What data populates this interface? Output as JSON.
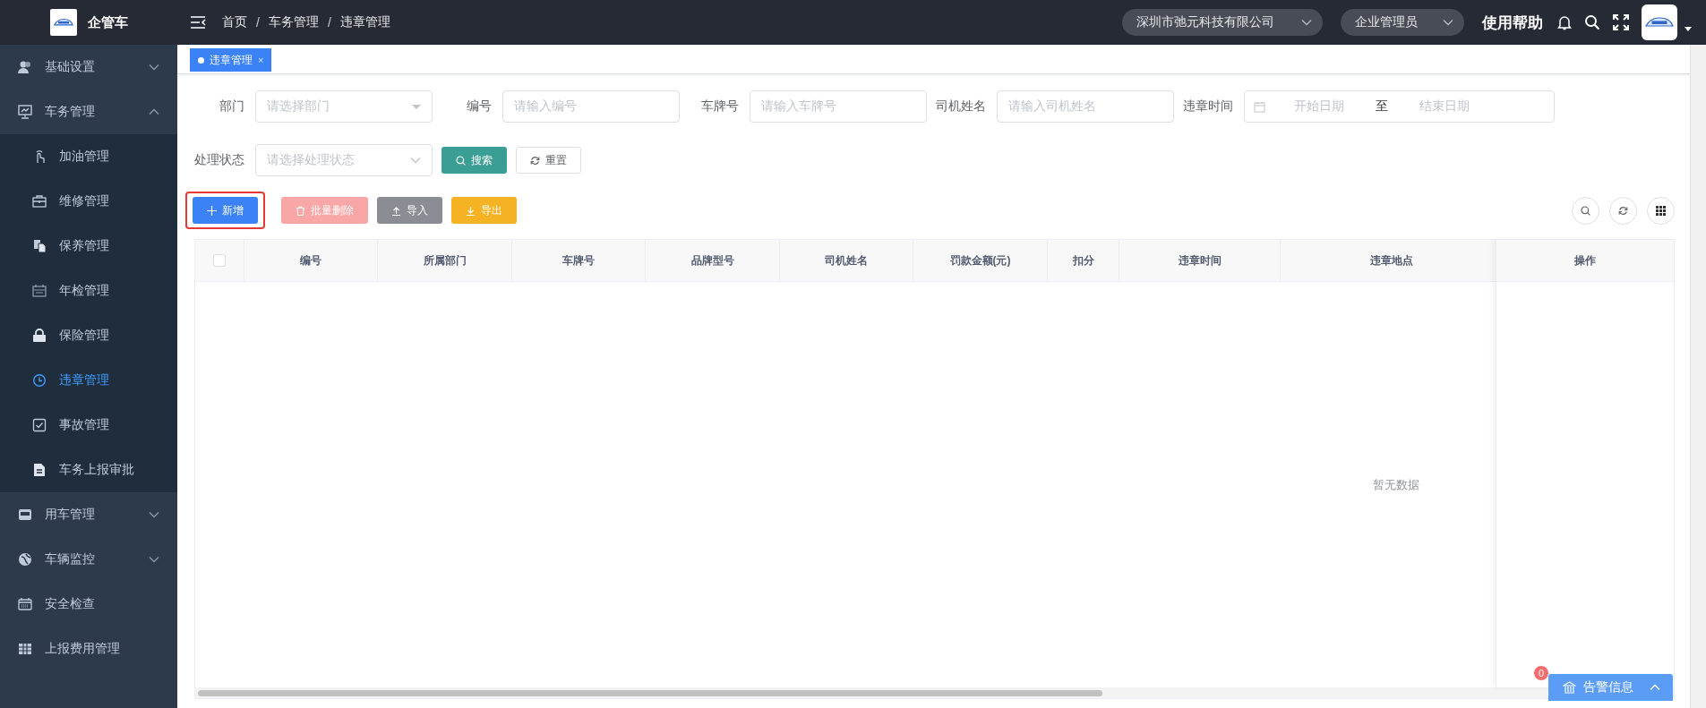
{
  "header": {
    "logo_text": "企管车",
    "breadcrumb": [
      {
        "label": "首页",
        "separator": "/"
      },
      {
        "label": "车务管理",
        "separator": "/"
      },
      {
        "label": "违章管理"
      }
    ],
    "company": "深圳市弛元科技有限公司",
    "role": "企业管理员",
    "help": "使用帮助"
  },
  "sidebar": {
    "items": [
      {
        "label": "基础设置",
        "selected": false,
        "expanded": false
      },
      {
        "label": "车务管理",
        "selected": false,
        "expanded": true,
        "children": [
          {
            "label": "加油管理",
            "selected": false
          },
          {
            "label": "维修管理",
            "selected": false
          },
          {
            "label": "保养管理",
            "selected": false
          },
          {
            "label": "年检管理",
            "selected": false
          },
          {
            "label": "保险管理",
            "selected": false
          },
          {
            "label": "违章管理",
            "selected": true
          },
          {
            "label": "事故管理",
            "selected": false
          },
          {
            "label": "车务上报审批",
            "selected": false
          }
        ]
      },
      {
        "label": "用车管理",
        "selected": false,
        "expanded": false
      },
      {
        "label": "车辆监控",
        "selected": false,
        "expanded": false
      },
      {
        "label": "安全检查",
        "selected": false
      },
      {
        "label": "上报费用管理",
        "selected": false
      }
    ]
  },
  "tabs": [
    {
      "label": "违章管理",
      "selected": true,
      "close": "×"
    }
  ],
  "filters": [
    {
      "kind": "select",
      "label": "部门",
      "placeholder": "请选择部门"
    },
    {
      "kind": "input",
      "label": "编号",
      "placeholder": "请输入编号"
    },
    {
      "kind": "input",
      "label": "车牌号",
      "placeholder": "请输入车牌号"
    },
    {
      "kind": "input",
      "label": "司机姓名",
      "placeholder": "请输入司机姓名"
    },
    {
      "kind": "daterange",
      "label": "违章时间",
      "start_placeholder": "开始日期",
      "separator": "至",
      "end_placeholder": "结束日期"
    },
    {
      "kind": "select",
      "label": "处理状态",
      "placeholder": "请选择处理状态"
    }
  ],
  "search_buttons": [
    {
      "kind": "primary",
      "label": "搜索"
    },
    {
      "kind": "plain",
      "label": "重置"
    }
  ],
  "toolbar": [
    {
      "kind": "primary",
      "label": "新增",
      "highlighted": true,
      "disabled": false
    },
    {
      "kind": "danger",
      "label": "批量删除",
      "highlighted": false,
      "disabled": true
    },
    {
      "kind": "info",
      "label": "导入",
      "highlighted": false,
      "disabled": false
    },
    {
      "kind": "warning",
      "label": "导出",
      "highlighted": false,
      "disabled": false
    }
  ],
  "table": {
    "select_all": {
      "checked": false
    },
    "columns": [
      "编号",
      "所属部门",
      "车牌号",
      "品牌型号",
      "司机姓名",
      "罚款金额(元)",
      "扣分",
      "违章时间",
      "违章地点"
    ],
    "fixed_column": "操作",
    "empty_text": "暂无数据"
  },
  "alert": {
    "label": "告警信息",
    "count": "0"
  }
}
